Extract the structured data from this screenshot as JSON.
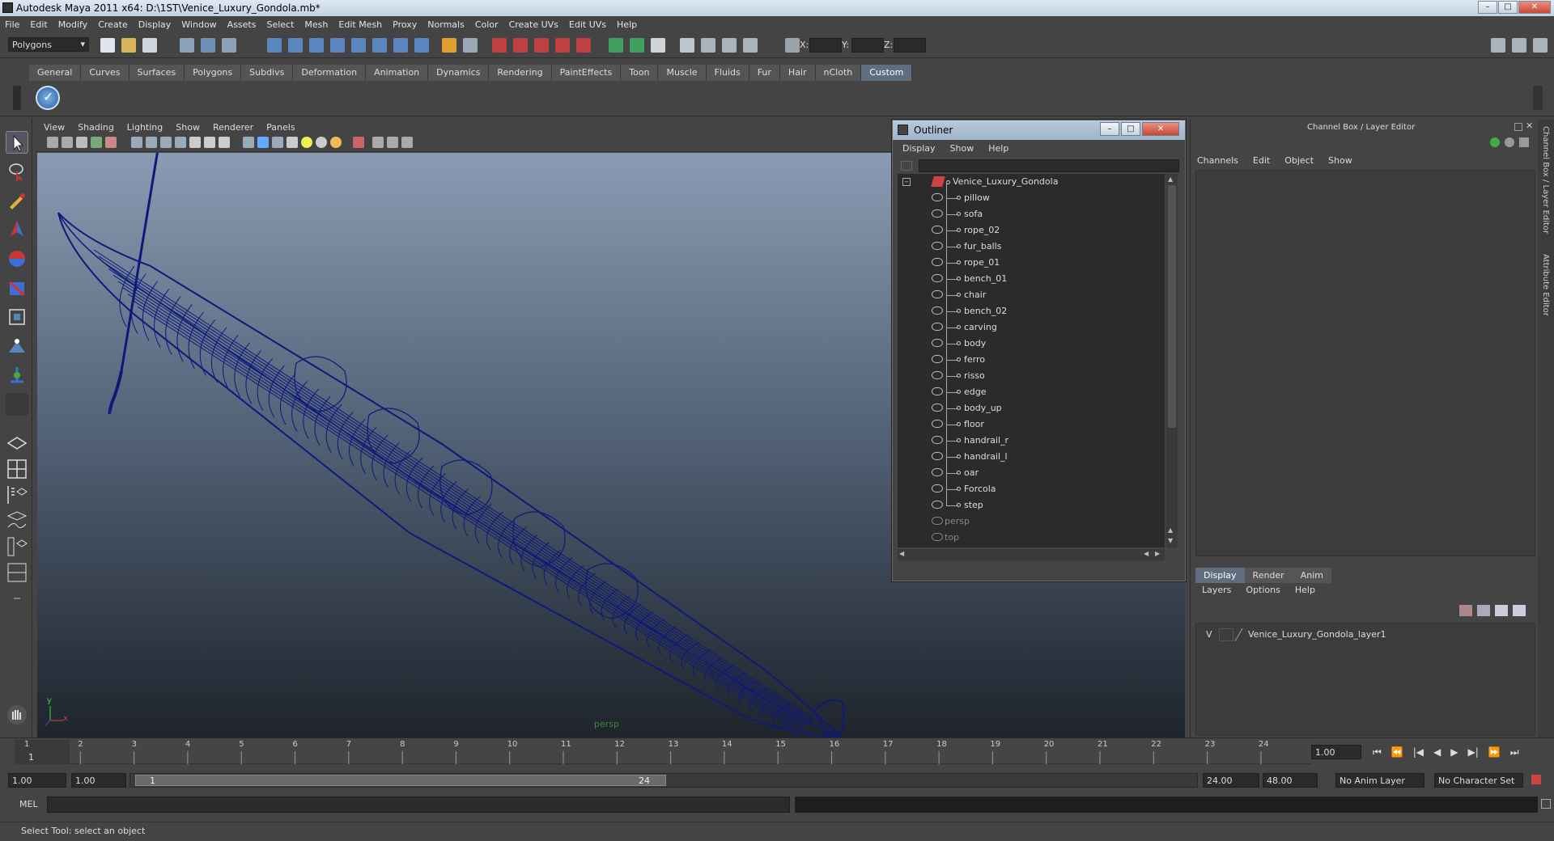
{
  "window": {
    "title": "Autodesk Maya 2011 x64: D:\\1ST\\Venice_Luxury_Gondola.mb*",
    "min_label": "–",
    "max_label": "□",
    "close_label": "✕"
  },
  "menubar": [
    "File",
    "Edit",
    "Modify",
    "Create",
    "Display",
    "Window",
    "Assets",
    "Select",
    "Mesh",
    "Edit Mesh",
    "Proxy",
    "Normals",
    "Color",
    "Create UVs",
    "Edit UVs",
    "Help"
  ],
  "statusline": {
    "mode": "Polygons",
    "x_label": "X:",
    "y_label": "Y:",
    "z_label": "Z:"
  },
  "shelf_tabs": [
    "General",
    "Curves",
    "Surfaces",
    "Polygons",
    "Subdivs",
    "Deformation",
    "Animation",
    "Dynamics",
    "Rendering",
    "PaintEffects",
    "Toon",
    "Muscle",
    "Fluids",
    "Fur",
    "Hair",
    "nCloth",
    "Custom"
  ],
  "shelf_active": "Custom",
  "viewport": {
    "menu": [
      "View",
      "Shading",
      "Lighting",
      "Show",
      "Renderer",
      "Panels"
    ],
    "camera_label": "persp",
    "axis_x": "x",
    "axis_y": "y",
    "wire_color": "#0d1a7a"
  },
  "outliner": {
    "title": "Outliner",
    "menu": [
      "Display",
      "Show",
      "Help"
    ],
    "root": "Venice_Luxury_Gondola",
    "children": [
      "pillow",
      "sofa",
      "rope_02",
      "fur_balls",
      "rope_01",
      "bench_01",
      "chair",
      "bench_02",
      "carving",
      "body",
      "ferro",
      "risso",
      "edge",
      "body_up",
      "floor",
      "handrail_r",
      "handrail_l",
      "oar",
      "Forcola",
      "step"
    ],
    "cameras": [
      "persp",
      "top"
    ]
  },
  "channelbox": {
    "title": "Channel Box / Layer Editor",
    "menu": [
      "Channels",
      "Edit",
      "Object",
      "Show"
    ],
    "layer_tabs": [
      "Display",
      "Render",
      "Anim"
    ],
    "layer_menu": [
      "Layers",
      "Options",
      "Help"
    ],
    "layer_visibility": "V",
    "layer_name": "Venice_Luxury_Gondola_layer1",
    "side_tab_1": "Channel Box / Layer Editor",
    "side_tab_2": "Attribute Editor"
  },
  "timeline": {
    "ticks": [
      "1",
      "2",
      "3",
      "4",
      "5",
      "6",
      "7",
      "8",
      "9",
      "10",
      "11",
      "12",
      "13",
      "14",
      "15",
      "16",
      "17",
      "18",
      "19",
      "20",
      "21",
      "22",
      "23",
      "24"
    ],
    "current_frame": "1",
    "current_time_field": "1.00"
  },
  "range": {
    "start": "1.00",
    "anim_start": "1.00",
    "slider_start": "1",
    "slider_end": "24",
    "anim_end": "24.00",
    "end": "48.00",
    "anim_layer": "No Anim Layer",
    "char_set": "No Character Set"
  },
  "cmdline": {
    "label": "MEL"
  },
  "helpline": {
    "text": "Select Tool: select an object"
  }
}
